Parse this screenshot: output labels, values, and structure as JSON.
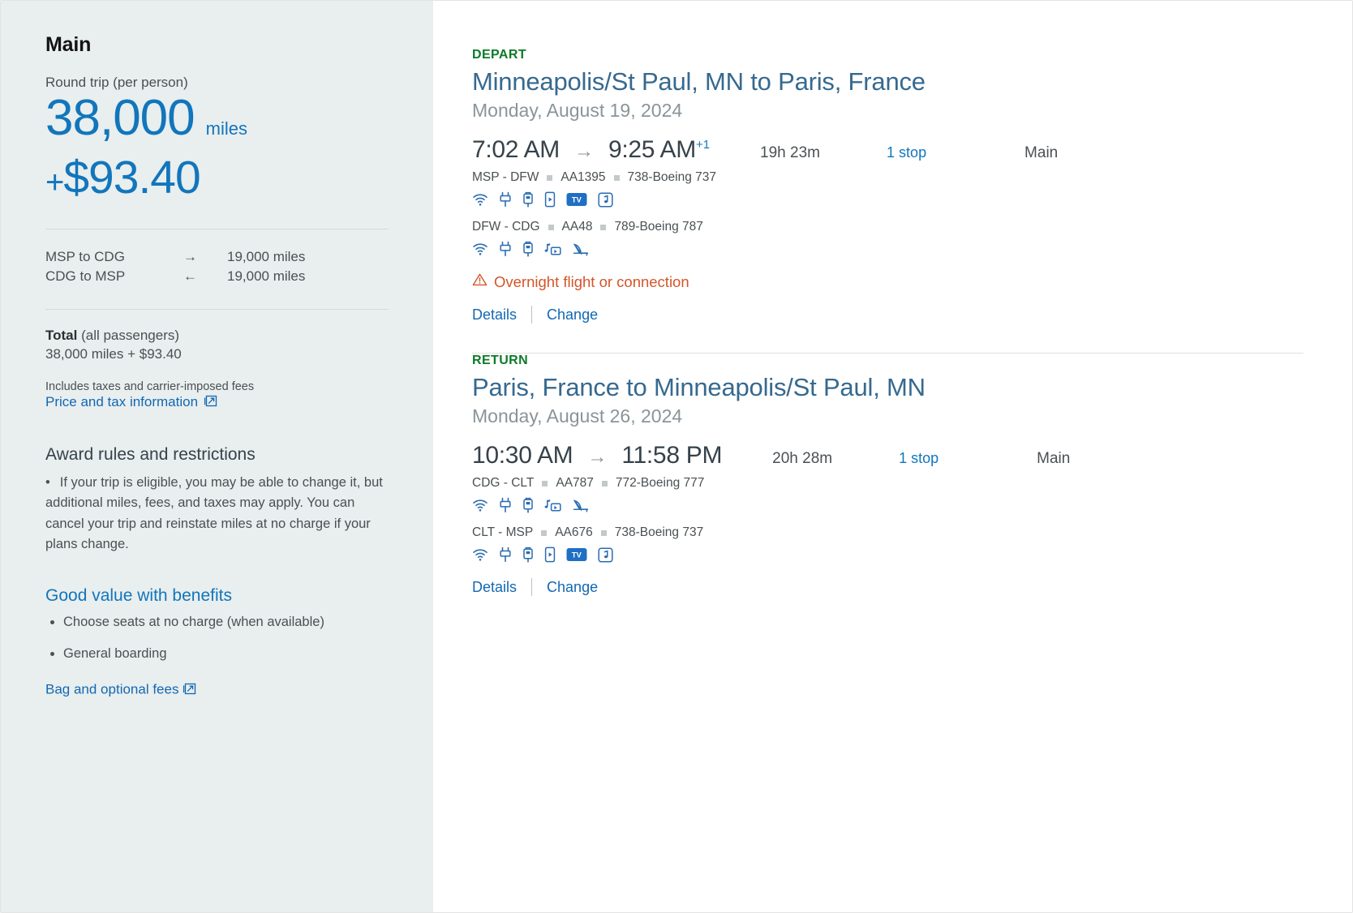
{
  "sidebar": {
    "cabin": "Main",
    "roundtrip_label": "Round trip (per person)",
    "miles_amount": "38,000",
    "miles_unit": "miles",
    "price_plus": "+",
    "price_amount": "$93.40",
    "legs": [
      {
        "route": "MSP to CDG",
        "arrow": "→",
        "miles": "19,000 miles"
      },
      {
        "route": "CDG to MSP",
        "arrow": "←",
        "miles": "19,000 miles"
      }
    ],
    "total_label_bold": "Total",
    "total_label_rest": " (all passengers)",
    "total_amount": "38,000 miles + $93.40",
    "taxes_note": "Includes taxes and carrier-imposed fees",
    "price_tax_link": "Price and tax information",
    "award_rules_heading": "Award rules and restrictions",
    "award_rules_text": "If your trip is eligible, you may be able to change it, but additional miles, fees, and taxes may apply. You can cancel your trip and reinstate miles at no charge if your plans change.",
    "benefits_heading": "Good value with benefits",
    "benefits": [
      "Choose seats at no charge (when available)",
      "General boarding"
    ],
    "bag_fees_link": "Bag and optional fees"
  },
  "itineraries": [
    {
      "direction_label": "DEPART",
      "route": "Minneapolis/St Paul, MN to Paris, France",
      "date": "Monday, August 19, 2024",
      "depart_time": "7:02 AM",
      "arrow": "→",
      "arrive_time": "9:25 AM",
      "day_offset": "+1",
      "duration": "19h 23m",
      "stops": "1 stop",
      "cabin": "Main",
      "segments": [
        {
          "airports": "MSP - DFW",
          "flight_number": "AA1395",
          "aircraft": "738-Boeing 737",
          "amenities": [
            "wifi-icon",
            "power-outlet-icon",
            "usb-port-icon",
            "device-streaming-icon",
            "tv-icon",
            "music-icon"
          ]
        },
        {
          "airports": "DFW - CDG",
          "flight_number": "AA48",
          "aircraft": "789-Boeing 787",
          "amenities": [
            "wifi-icon",
            "power-outlet-icon",
            "usb-port-icon",
            "media-video-icon",
            "lie-flat-seat-icon"
          ]
        }
      ],
      "warning": "Overnight flight or connection",
      "details_label": "Details",
      "change_label": "Change"
    },
    {
      "direction_label": "RETURN",
      "route": "Paris, France to Minneapolis/St Paul, MN",
      "date": "Monday, August 26, 2024",
      "depart_time": "10:30 AM",
      "arrow": "→",
      "arrive_time": "11:58 PM",
      "day_offset": "",
      "duration": "20h 28m",
      "stops": "1 stop",
      "cabin": "Main",
      "segments": [
        {
          "airports": "CDG - CLT",
          "flight_number": "AA787",
          "aircraft": "772-Boeing 777",
          "amenities": [
            "wifi-icon",
            "power-outlet-icon",
            "usb-port-icon",
            "media-video-icon",
            "lie-flat-seat-icon"
          ]
        },
        {
          "airports": "CLT - MSP",
          "flight_number": "AA676",
          "aircraft": "738-Boeing 737",
          "amenities": [
            "wifi-icon",
            "power-outlet-icon",
            "usb-port-icon",
            "device-streaming-icon",
            "tv-icon",
            "music-icon"
          ]
        }
      ],
      "warning": "",
      "details_label": "Details",
      "change_label": "Change"
    }
  ],
  "colors": {
    "brand_blue": "#1176bc",
    "link_blue": "#1268b3",
    "depart_green": "#0e7a28",
    "warning_orange": "#d4552a",
    "sidebar_bg": "#e9eeee",
    "route_blue": "#36698f"
  }
}
